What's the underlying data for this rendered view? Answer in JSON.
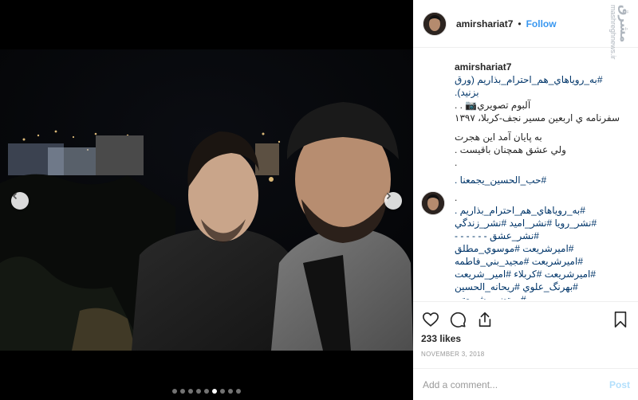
{
  "post": {
    "username": "amirshariat7",
    "separator": "•",
    "follow_label": "Follow",
    "watermark_logo": "مشرق",
    "watermark_text": "mashreghnews.ir"
  },
  "caption": {
    "username": "amirshariat7",
    "lines": [
      "#به_روياهاي_هم_احترام_بذاريم (ورق بزنيد).",
      "آلبوم تصويري📷 . .",
      "سفرنامه ي اربعين مسير نجف-كربلا، ۱۳۹۷",
      "به پايان آمد اين هجرت",
      "ولي عشق همچنان باقيست .",
      "."
    ],
    "hashtag": "#حب_الحسين_يجمعنا ."
  },
  "comment": {
    "lines": [
      ".",
      "#به_روياهاي_هم_احترام_بذاريم .",
      "#نشر_رويا #نشر_اميد #نشر_زندگي",
      "#نشر_عشق - - - - - -",
      "#اميرشريعت #موسوي_مطلق",
      "#اميرشريعت #مجيد_بني_فاطمه",
      "#اميرشريعت #كربلاء #امير_شريعت",
      "#بهرنگ_علوي #ريحانه_الحسين",
      "#مرتضي_شريعتي"
    ]
  },
  "actions": {
    "like_icon": "heart-icon",
    "comment_icon": "comment-icon",
    "share_icon": "share-icon",
    "save_icon": "bookmark-icon"
  },
  "likes": "233 likes",
  "date": "NOVEMBER 3, 2018",
  "add_comment": {
    "placeholder": "Add a comment...",
    "post_label": "Post"
  },
  "carousel": {
    "count": 9,
    "active": 5
  },
  "colors": {
    "link": "#3897f0",
    "hashtag": "#003569",
    "post_disabled": "#b2dffc"
  }
}
